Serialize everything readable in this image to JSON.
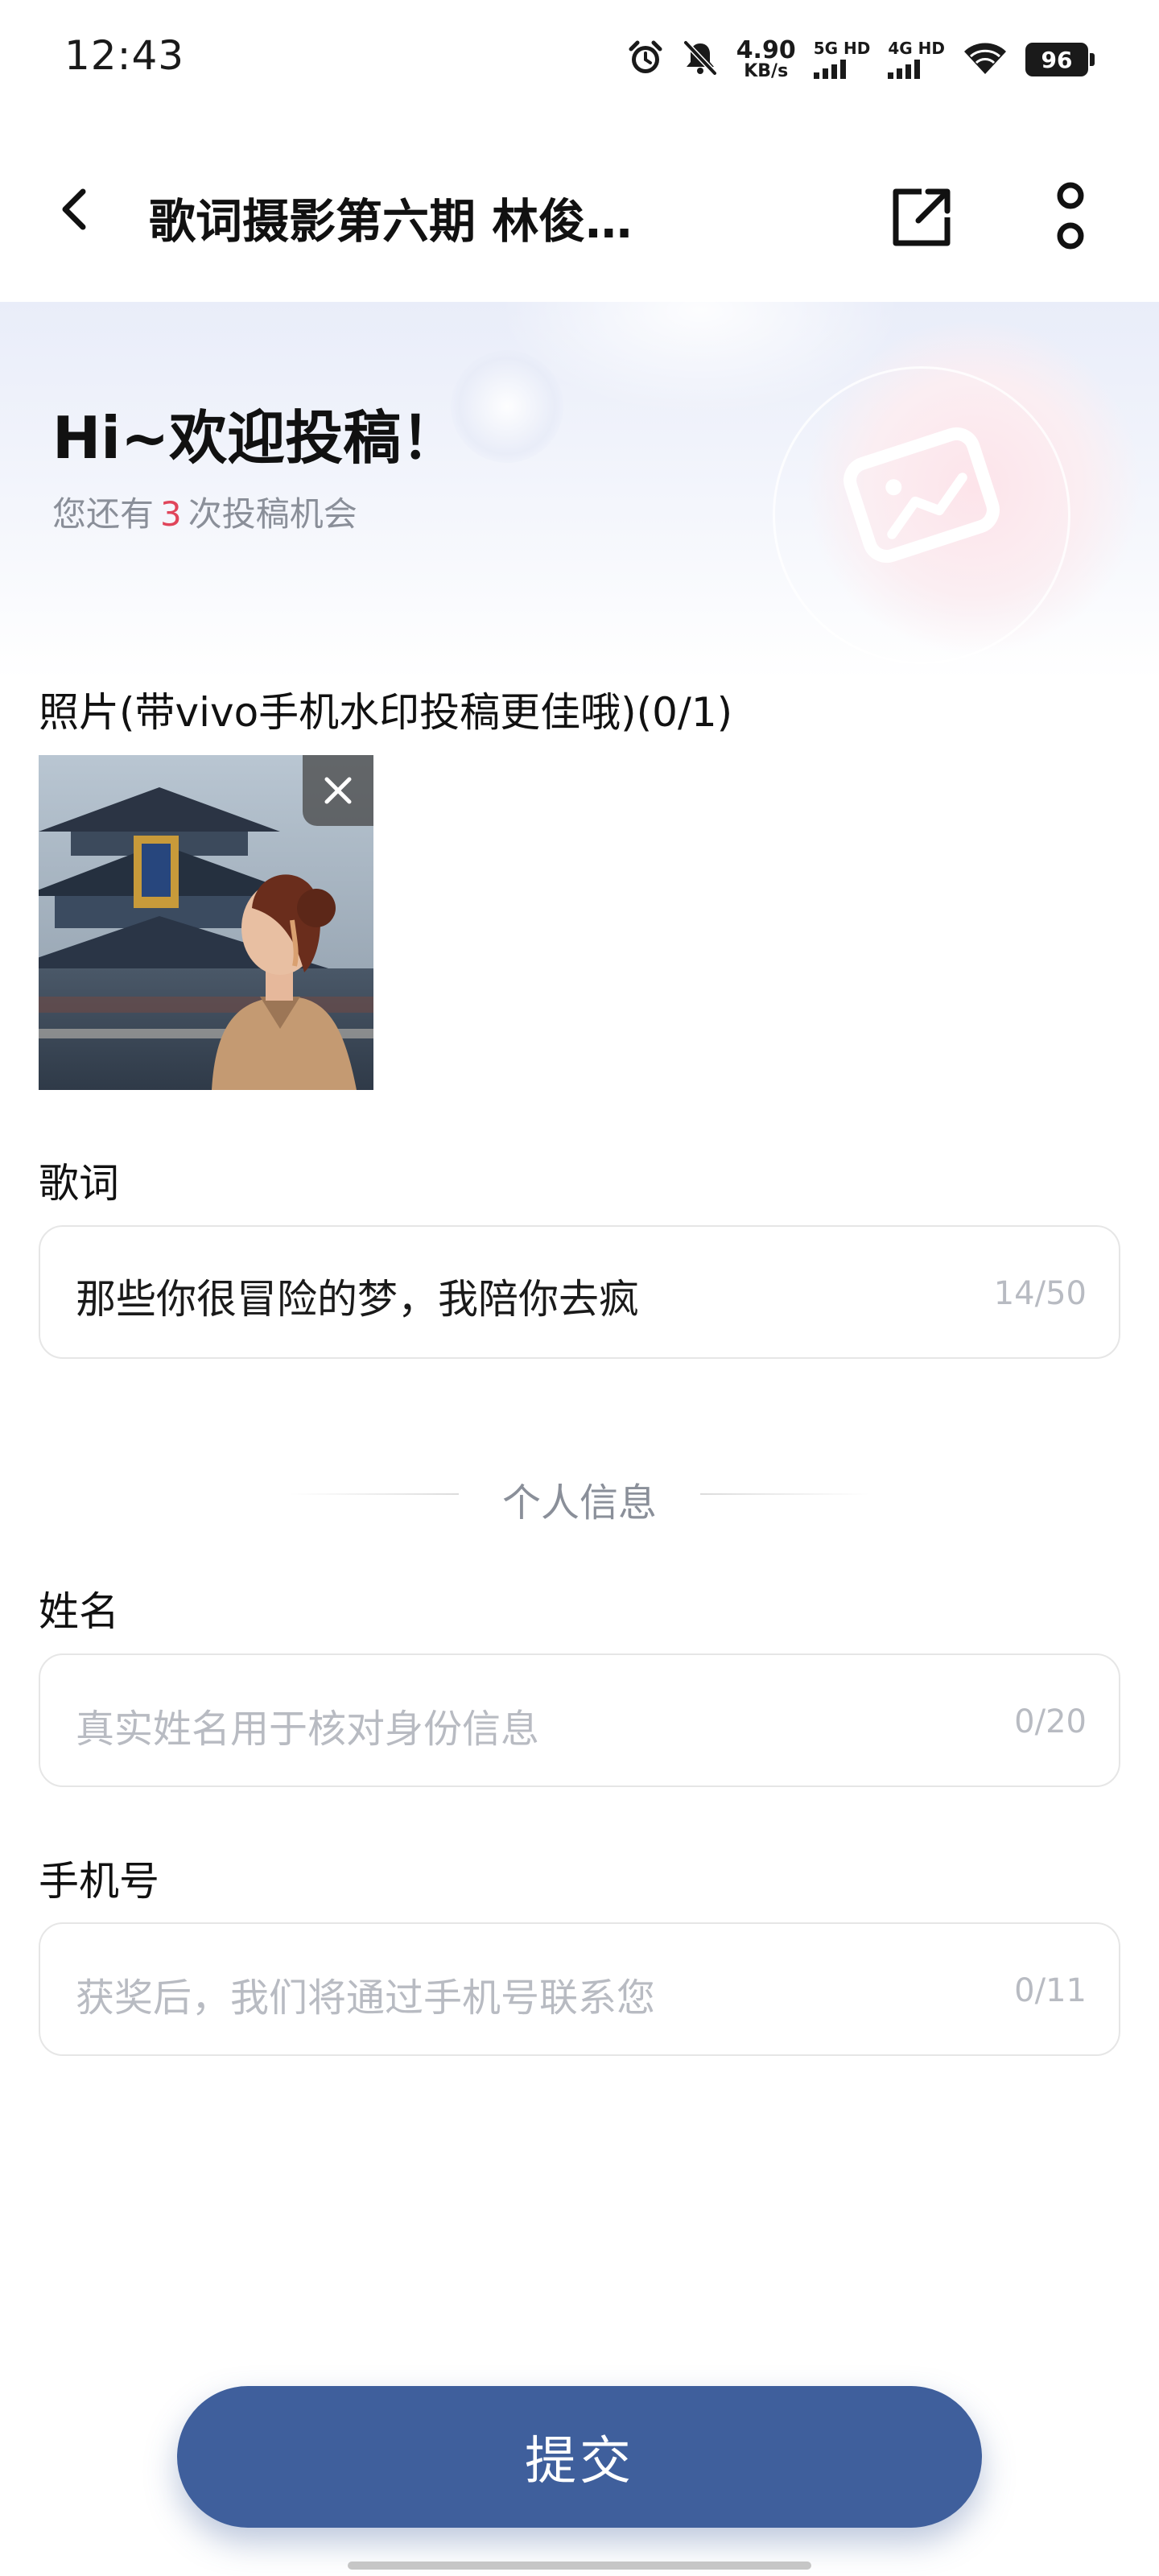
{
  "status_bar": {
    "time": "12:43",
    "speed_value": "4.90",
    "speed_unit": "KB/s",
    "sim1_label": "5G HD",
    "sim2_label": "4G HD",
    "battery": "96",
    "icons": [
      "alarm-icon",
      "mute-icon",
      "signal-icon",
      "wifi-icon",
      "battery-icon"
    ]
  },
  "header": {
    "title": "歌词摄影第六期 林俊…",
    "icons": [
      "back-arrow-icon",
      "share-external-icon",
      "more-vertical-icon"
    ]
  },
  "banner": {
    "greeting": "Hi~欢迎投稿！",
    "chances_prefix": "您还有",
    "chances_count": "3",
    "chances_suffix": "次投稿机会"
  },
  "photo": {
    "label": "照片(带vivo手机水印投稿更佳哦)(0/1)",
    "remove_icon": "close-icon"
  },
  "lyrics": {
    "label": "歌词",
    "value": "那些你很冒险的梦，我陪你去疯",
    "count": "14/50"
  },
  "divider": {
    "text": "个人信息"
  },
  "name": {
    "label": "姓名",
    "placeholder": "真实姓名用于核对身份信息",
    "count": "0/20"
  },
  "phone": {
    "label": "手机号",
    "placeholder": "获奖后，我们将通过手机号联系您",
    "count": "0/11"
  },
  "submit": {
    "label": "提交"
  },
  "colors": {
    "accent": "#3f5f9c",
    "highlight": "#e0455a",
    "placeholder": "#b8bbc2"
  }
}
